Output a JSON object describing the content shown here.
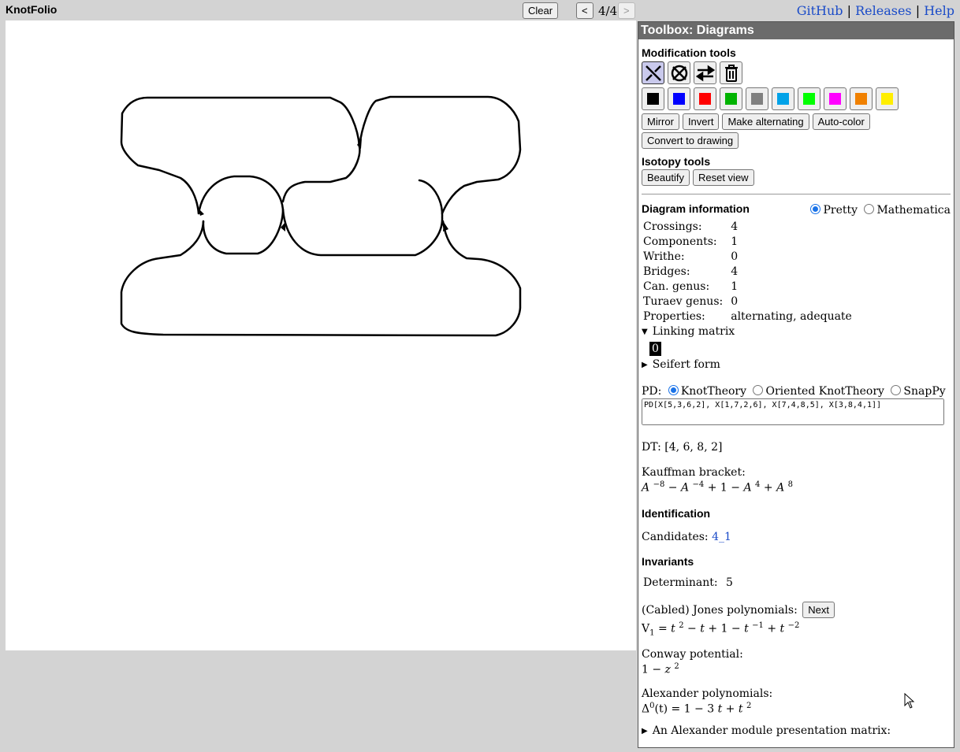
{
  "app": {
    "title": "KnotFolio"
  },
  "topbar": {
    "clear_label": "Clear",
    "prev_label": "<",
    "page": "4/4",
    "next_label": ">"
  },
  "links": {
    "github": "GitHub",
    "releases": "Releases",
    "help": "Help",
    "sep": "|"
  },
  "toolbox": {
    "title": "Toolbox: Diagrams",
    "modification_heading": "Modification tools",
    "tools": [
      "crossing-toggle-icon",
      "crossing-delete-icon",
      "reverse-orientation-icon",
      "trash-icon"
    ],
    "colors": [
      "#000000",
      "#0000ff",
      "#ff0000",
      "#00b300",
      "#808080",
      "#00a2e8",
      "#00ff00",
      "#ff00ff",
      "#f08000",
      "#ffee00"
    ],
    "buttons": {
      "mirror": "Mirror",
      "invert": "Invert",
      "make_alternating": "Make alternating",
      "auto_color": "Auto-color",
      "convert": "Convert to drawing"
    },
    "isotopy_heading": "Isotopy tools",
    "isotopy": {
      "beautify": "Beautify",
      "reset_view": "Reset view"
    }
  },
  "info": {
    "heading": "Diagram information",
    "format_options": [
      "Pretty",
      "Mathematica"
    ],
    "rows": [
      {
        "label": "Crossings:",
        "value": "4"
      },
      {
        "label": "Components:",
        "value": "1"
      },
      {
        "label": "Writhe:",
        "value": "0"
      },
      {
        "label": "Bridges:",
        "value": "4"
      },
      {
        "label": "Can. genus:",
        "value": "1"
      },
      {
        "label": "Turaev genus:",
        "value": "0"
      },
      {
        "label": "Properties:",
        "value": "alternating, adequate"
      }
    ],
    "linking_matrix_label": "Linking matrix",
    "linking_matrix_value": "0",
    "seifert_label": "Seifert form",
    "pd_label": "PD:",
    "pd_options": [
      "KnotTheory",
      "Oriented KnotTheory",
      "SnapPy"
    ],
    "pd_value": "PD[X[5,3,6,2], X[1,7,2,6], X[7,4,8,5], X[3,8,4,1]]",
    "dt": "DT: [4, 6, 8, 2]",
    "kauffman_label": "Kauffman bracket:"
  },
  "identification": {
    "heading": "Identification",
    "candidates_label": "Candidates:",
    "candidate": "4_1"
  },
  "invariants": {
    "heading": "Invariants",
    "determinant_label": "Determinant:",
    "determinant_value": "5",
    "jones_label": "(Cabled) Jones polynomials:",
    "jones_next": "Next",
    "conway_label": "Conway potential:",
    "alexander_label": "Alexander polynomials:",
    "alexander_module_label": "An Alexander module presentation matrix:"
  }
}
